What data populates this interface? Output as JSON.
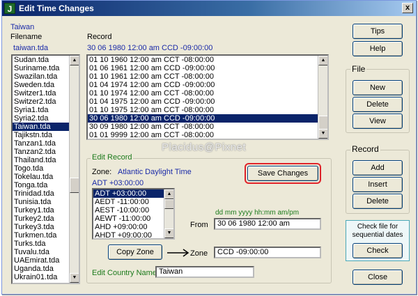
{
  "window": {
    "title": "Edit Time Changes",
    "app_icon_letter": "J",
    "close_glyph": "x"
  },
  "left": {
    "country_label": "Taiwan",
    "filename_label": "Filename",
    "filename_value": "taiwan.tda",
    "files": [
      "Sudan.tda",
      "Suriname.tda",
      "Swazilan.tda",
      "Sweden.tda",
      "Switzer1.tda",
      "Switzer2.tda",
      "Syria1.tda",
      "Syria2.tda",
      "Taiwan.tda",
      "Tajikstn.tda",
      "Tanzan1.tda",
      "Tanzan2.tda",
      "Thailand.tda",
      "Togo.tda",
      "Tokelau.tda",
      "Tonga.tda",
      "Trinidad.tda",
      "Tunisia.tda",
      "Turkey1.tda",
      "Turkey2.tda",
      "Turkey3.tda",
      "Turkmen.tda",
      "Turks.tda",
      "Tuvalu.tda",
      "UAEmirat.tda",
      "Uganda.tda",
      "Ukrain01.tda"
    ],
    "selected_file": "Taiwan.tda"
  },
  "record": {
    "label": "Record",
    "current": "30 06 1980 12:00 am CCD -09:00:00",
    "rows": [
      "01 10 1960 12:00 am CCT -08:00:00",
      "01 06 1961 12:00 am CCD -09:00:00",
      "01 10 1961 12:00 am CCT -08:00:00",
      "01 04 1974 12:00 am CCD -09:00:00",
      "01 10 1974 12:00 am CCT -08:00:00",
      "01 04 1975 12:00 am CCD -09:00:00",
      "01 10 1975 12:00 am CCT -08:00:00",
      "30 06 1980 12:00 am CCD -09:00:00",
      "30 09 1980 12:00 am CCT -08:00:00",
      "01 01 9999 12:00 am CCT -08:00:00"
    ],
    "selected_row": "30 06 1980 12:00 am CCD -09:00:00"
  },
  "edit_record": {
    "title": "Edit Record",
    "zone_label": "Zone:",
    "zone_name": "Atlantic Daylight Time",
    "zone_code": "ADT +03:00:00",
    "zones": [
      "ADT +03:00:00",
      "AEDT -11:00:00",
      "AEST -10:00:00",
      "AEWT -11:00:00",
      "AHD +09:00:00",
      "AHDT +09:00:00"
    ],
    "selected_zone": "ADT +03:00:00",
    "save_changes": "Save Changes",
    "date_format": "dd mm yyyy hh:mm am/pm",
    "from_label": "From",
    "from_value": "30 06 1980 12:00 am",
    "copy_zone": "Copy Zone",
    "zone_field_label": "Zone",
    "zone_field_value": "CCD -09:00:00",
    "country_name_label": "Edit Country Name",
    "country_name_value": "Taiwan"
  },
  "right": {
    "tips": "Tips",
    "help": "Help",
    "file_group": "File",
    "new": "New",
    "delete_file": "Delete",
    "view": "View",
    "record_group": "Record",
    "add": "Add",
    "insert": "Insert",
    "delete_record": "Delete",
    "check_text_1": "Check file for",
    "check_text_2": "sequential dates",
    "check": "Check",
    "close": "Close"
  },
  "watermark": "Placidus@Pixnet",
  "colors": {
    "selection": "#0a246a",
    "label_blue": "#1a2aa8",
    "label_green": "#1b7a1b",
    "highlight_red": "#e0242a"
  }
}
